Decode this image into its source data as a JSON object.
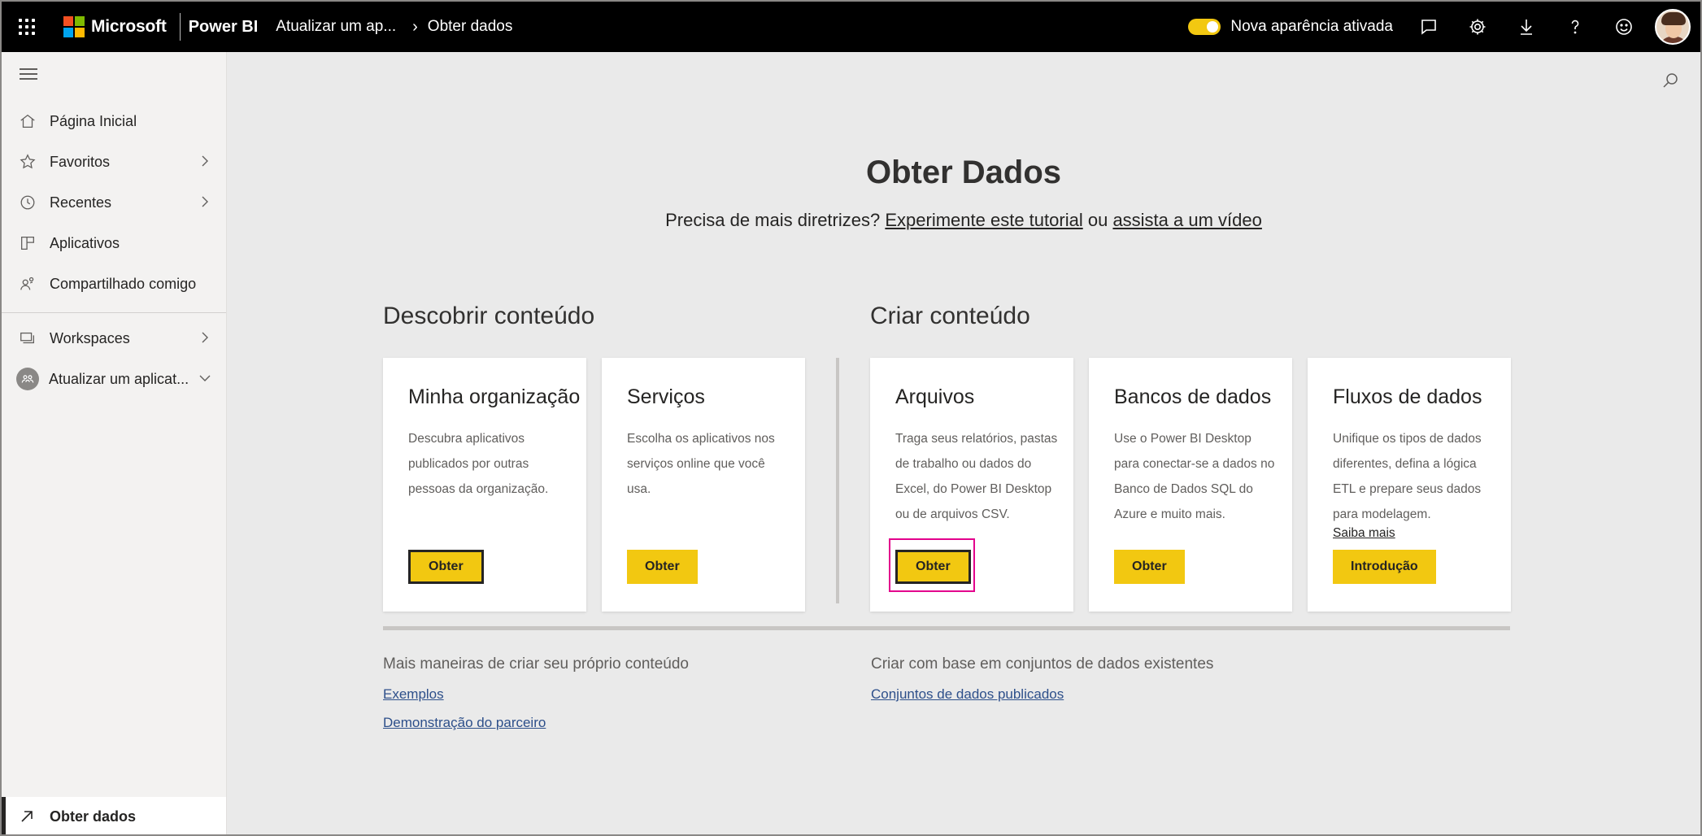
{
  "topbar": {
    "brand": "Microsoft",
    "product": "Power BI",
    "breadcrumb": [
      "Atualizar um ap...",
      "Obter dados"
    ],
    "toggle_label": "Nova aparência ativada",
    "toggle_on": true,
    "icons": [
      "chat-icon",
      "gear-icon",
      "download-icon",
      "help-icon",
      "smiley-icon"
    ]
  },
  "sidebar": {
    "items": [
      {
        "label": "Página Inicial",
        "icon": "home-icon",
        "expand": false
      },
      {
        "label": "Favoritos",
        "icon": "star-icon",
        "expand": true
      },
      {
        "label": "Recentes",
        "icon": "clock-icon",
        "expand": true
      },
      {
        "label": "Aplicativos",
        "icon": "apps-icon",
        "expand": false
      },
      {
        "label": "Compartilhado comigo",
        "icon": "shared-icon",
        "expand": false
      }
    ],
    "workspaces_label": "Workspaces",
    "workspace_current": "Atualizar um aplicat...",
    "bottom_label": "Obter dados"
  },
  "main": {
    "title": "Obter Dados",
    "subtitle_prefix": "Precisa de mais diretrizes?",
    "subtitle_link1": "Experimente este tutorial",
    "subtitle_mid": "ou",
    "subtitle_link2": "assista a um vídeo",
    "discover_heading": "Descobrir conteúdo",
    "create_heading": "Criar conteúdo",
    "cards": [
      {
        "title": "Minha organização",
        "desc": "Descubra aplicativos publicados por outras pessoas da organização.",
        "button": "Obter"
      },
      {
        "title": "Serviços",
        "desc": "Escolha os aplicativos nos serviços online que você usa.",
        "button": "Obter"
      },
      {
        "title": "Arquivos",
        "desc": "Traga seus relatórios, pastas de trabalho ou dados do Excel, do Power BI Desktop ou de arquivos CSV.",
        "button": "Obter"
      },
      {
        "title": "Bancos de dados",
        "desc": "Use o Power BI Desktop para conectar-se a dados no Banco de Dados SQL do Azure e muito mais.",
        "button": "Obter"
      },
      {
        "title": "Fluxos de dados",
        "desc": "Unifique os tipos de dados diferentes, defina a lógica ETL e prepare seus dados para modelagem.",
        "link": "Saiba mais",
        "button": "Introdução"
      }
    ],
    "more_left_heading": "Mais maneiras de criar seu próprio conteúdo",
    "more_left_links": [
      "Exemplos",
      "Demonstração do parceiro"
    ],
    "more_right_heading": "Criar com base em conjuntos de dados existentes",
    "more_right_links": [
      "Conjuntos de dados publicados"
    ]
  },
  "colors": {
    "accent": "#f2c811",
    "highlight": "#e3008c",
    "topbar": "#000000"
  }
}
